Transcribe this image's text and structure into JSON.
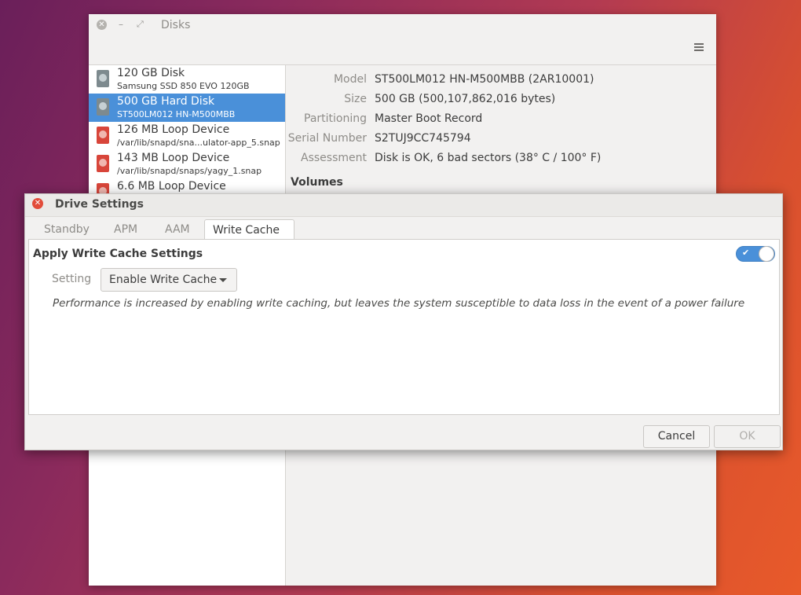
{
  "disks_window": {
    "title": "Disks",
    "drives": [
      {
        "name": "120 GB Disk",
        "sub": "Samsung SSD 850 EVO 120GB",
        "icon": "hard-disk-icon",
        "selected": false
      },
      {
        "name": "500 GB Hard Disk",
        "sub": "ST500LM012 HN-M500MBB",
        "icon": "hard-disk-icon",
        "selected": true
      },
      {
        "name": "126 MB Loop Device",
        "sub": "/var/lib/snapd/sna...ulator-app_5.snap",
        "icon": "loop-device-icon",
        "selected": false
      },
      {
        "name": "143 MB Loop Device",
        "sub": "/var/lib/snapd/snaps/yagy_1.snap",
        "icon": "loop-device-icon",
        "selected": false
      },
      {
        "name": "6.6 MB Loop Device",
        "sub": "",
        "icon": "loop-device-icon",
        "selected": false
      }
    ],
    "details": [
      {
        "label": "Model",
        "value": "ST500LM012 HN-M500MBB (2AR10001)"
      },
      {
        "label": "Size",
        "value": "500 GB (500,107,862,016 bytes)"
      },
      {
        "label": "Partitioning",
        "value": "Master Boot Record"
      },
      {
        "label": "Serial Number",
        "value": "S2TUJ9CC745794"
      },
      {
        "label": "Assessment",
        "value": "Disk is OK, 6 bad sectors (38° C / 100° F)"
      }
    ],
    "volumes_heading": "Volumes"
  },
  "dialog": {
    "title": "Drive Settings",
    "tabs": [
      "Standby",
      "APM",
      "AAM",
      "Write Cache"
    ],
    "active_tab": "Write Cache",
    "heading": "Apply Write Cache Settings",
    "toggle_on": true,
    "setting_label": "Setting",
    "setting_value": "Enable Write Cache",
    "description": "Performance is increased by enabling write caching, but leaves the system susceptible to data loss in the event of a power failure",
    "cancel_label": "Cancel",
    "ok_label": "OK"
  },
  "colors": {
    "accent": "#4a90d9",
    "close_red": "#e24c3a"
  }
}
